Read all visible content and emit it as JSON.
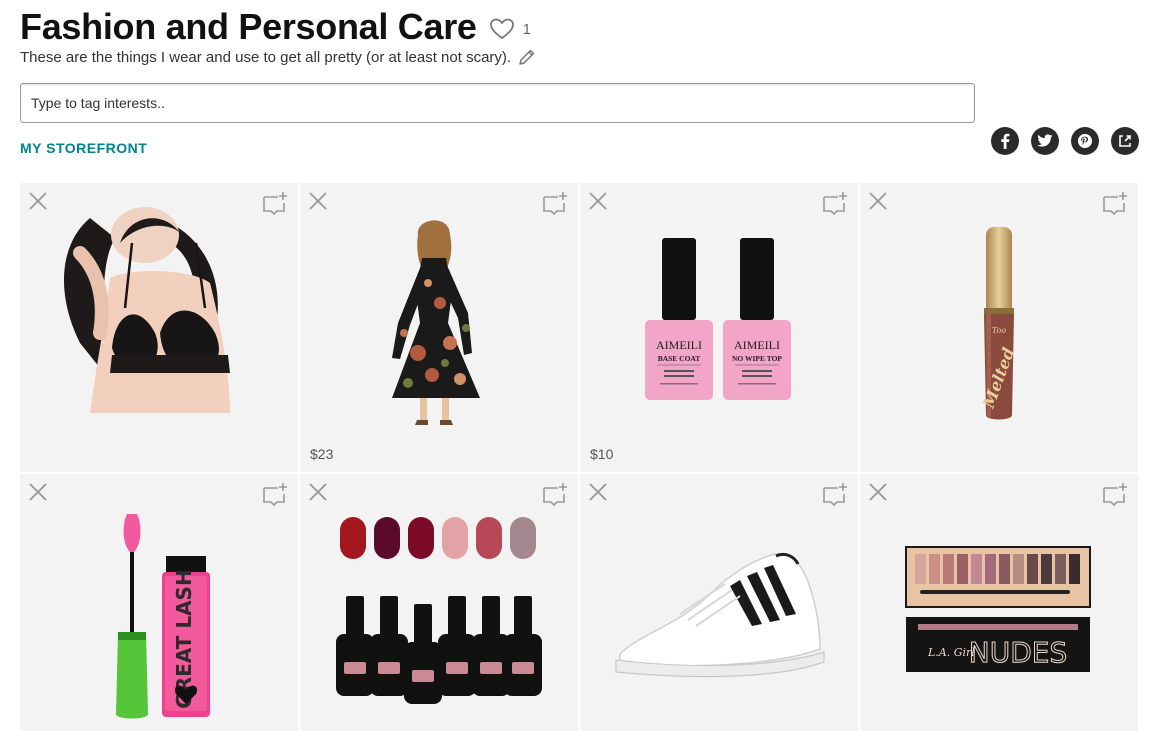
{
  "header": {
    "title": "Fashion and Personal Care",
    "like_count": "1",
    "description": "These are the things I wear and use to get all pretty (or at least not scary)."
  },
  "tag_input": {
    "placeholder": "Type to tag interests.."
  },
  "storefront_link": "MY STOREFRONT",
  "social": [
    "facebook-icon",
    "twitter-icon",
    "pinterest-icon",
    "share-icon"
  ],
  "products": [
    {
      "name": "black lace bralette",
      "price": ""
    },
    {
      "name": "floral long-sleeve dress",
      "price": "$23"
    },
    {
      "name": "AIMEILI base coat and no wipe top coat",
      "price": "$10",
      "labels": [
        "AIMEILI",
        "BASE COAT",
        "AIMEILI",
        "NO WIPE TOP"
      ]
    },
    {
      "name": "Too Faced Melted Matte lipstick",
      "price": ""
    },
    {
      "name": "pink mascara GREAT LASH",
      "price": "",
      "labels": [
        "GREAT LASH"
      ]
    },
    {
      "name": "gel nail polish set",
      "price": ""
    },
    {
      "name": "white sneakers with black stripes",
      "price": ""
    },
    {
      "name": "L.A. Girl NUDES eyeshadow palette",
      "price": "",
      "labels": [
        "L.A. Girl",
        "NUDES"
      ]
    }
  ]
}
